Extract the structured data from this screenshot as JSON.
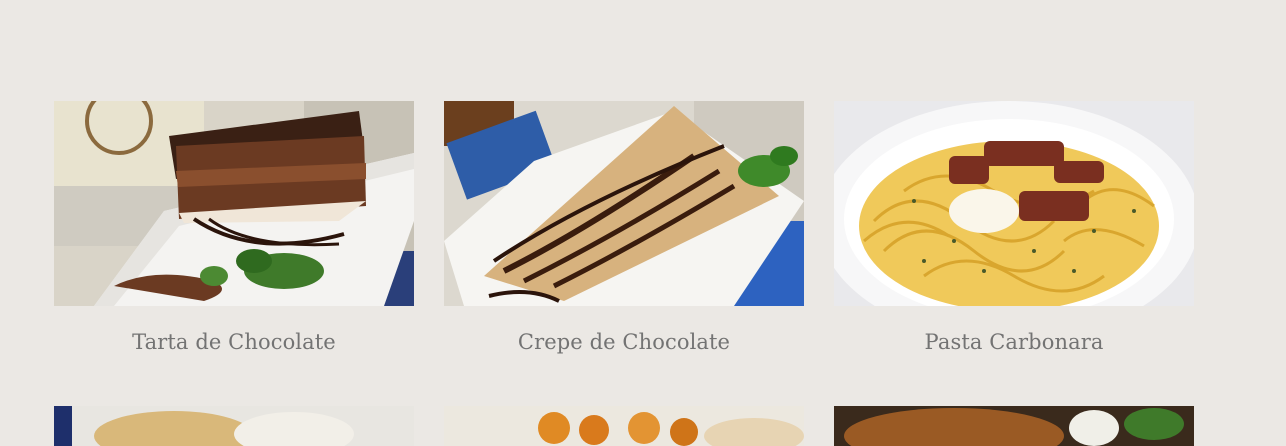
{
  "menu": {
    "items": [
      {
        "name": "Tarta de Chocolate"
      },
      {
        "name": "Crepe de Chocolate"
      },
      {
        "name": "Pasta Carbonara"
      }
    ],
    "next_row": [
      {
        "name": ""
      },
      {
        "name": ""
      },
      {
        "name": ""
      }
    ]
  }
}
